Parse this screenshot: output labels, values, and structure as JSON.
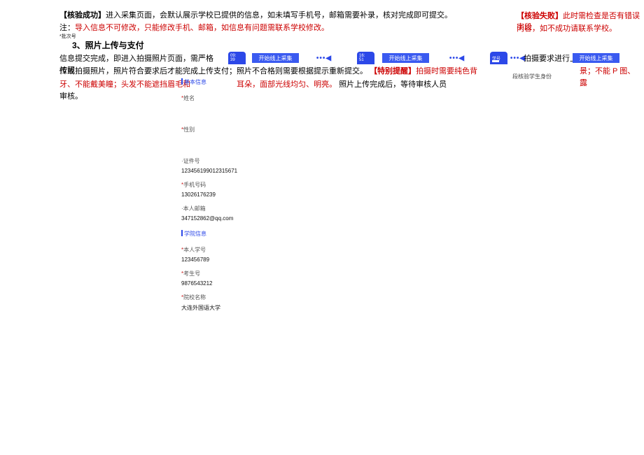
{
  "top": {
    "p1_prefix": "【核验成功】",
    "p1_rest": "进入采集页面，会默认展示学校已提供的信息，如未填写手机号，邮箱需要补录，核对完成即可提交。",
    "p1_right_a_prefix": "【核验失败】",
    "p1_right_a_rest": "此时需检查是否有错误字段",
    "p1_right_b": "内容，如不成功请联系学校。",
    "p2_prefix": "注：",
    "p2_rest": "导入信息不可修改，只能修改手机、邮箱，如信息有问题需联系学校修改。",
    "batch": "*批次号",
    "heading": "3、照片上传与支付"
  },
  "row": {
    "txt_left": "信息提交完成，即进入拍摄照片页面，需严格按照",
    "txt_right": "拍摄要求进行上",
    "phone_a_time": "09:\n39",
    "phone_b_time": "16:\n51",
    "phone_c_text": "学号",
    "btn_a": "开始线上采集",
    "btn_b": "开始线上采集",
    "btn_c": "开始线上采集",
    "dots": "•••◀"
  },
  "flow": {
    "l2a": "传或拍摄照片，照片符合要求后才能完成上传支付；照片不合格则需要根据提示重新提交。",
    "l2b_prefix": "【特别提醒】",
    "l2b_rest": "拍摄时需要纯色背",
    "l2r": "景；不能 P 图、露",
    "l3a": "牙、不能戴美瞳；头发不能遮挡眉毛和",
    "l3b": "耳朵，面部光线均匀、明亮。",
    "l3c": "照片上传完成后，等待审核人员审核。",
    "verify": "段核验学生身份"
  },
  "form": {
    "sec1": "基本信息",
    "name_l": "姓名",
    "gender_l": "性别",
    "id_l": "证件号",
    "id_v": "123456199012315671",
    "phone_l": "手机号码",
    "phone_v": "13026176239",
    "mail_l": "本人邮箱",
    "mail_v": "347152862@qq.com",
    "sec2": "学院信息",
    "stu_l": "本人学号",
    "stu_v": "123456789",
    "exam_l": "考生号",
    "exam_v": "9876543212",
    "sch_l": "院校名称",
    "sch_v": "大连外国语大学"
  }
}
